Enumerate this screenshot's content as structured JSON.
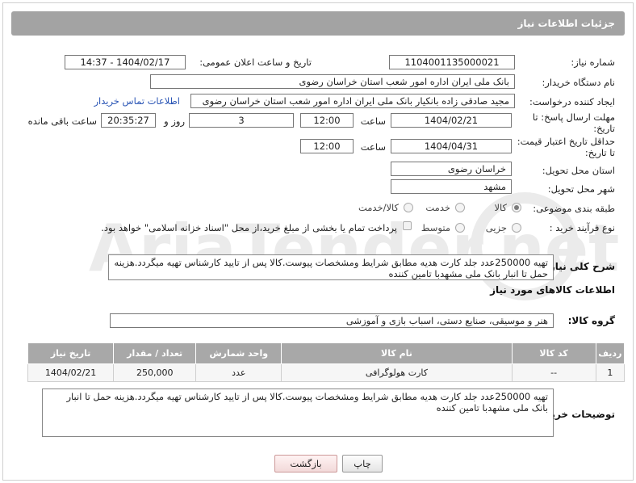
{
  "header": {
    "title": "جزئیات اطلاعات نیاز"
  },
  "form": {
    "need_number_label": "شماره نیاز:",
    "need_number": "1104001135000021",
    "announce_label": "تاریخ و ساعت اعلان عمومی:",
    "announce_value": "1404/02/17 - 14:37",
    "buyer_org_label": "نام دستگاه خریدار:",
    "buyer_org": "بانک ملی ایران اداره امور شعب استان خراسان رضوی",
    "creator_label": "ایجاد کننده درخواست:",
    "creator": "مجید صادقی زاده بانکیار بانک ملی ایران اداره امور شعب استان خراسان رضوی",
    "contact_link": "اطلاعات تماس خریدار",
    "deadline_label_1": "مهلت ارسال پاسخ: تا",
    "deadline_label_2": "تاریخ:",
    "deadline_date": "1404/02/21",
    "time_label": "ساعت",
    "deadline_time": "12:00",
    "days_value": "3",
    "days_label": "روز و",
    "remaining_time": "20:35:27",
    "remaining_label": "ساعت باقی مانده",
    "validity_label_1": "حداقل تاریخ اعتبار قیمت:",
    "validity_label_2": "تا تاریخ:",
    "validity_date": "1404/04/31",
    "validity_time": "12:00",
    "province_label": "استان محل تحویل:",
    "province": "خراسان رضوی",
    "city_label": "شهر محل تحویل:",
    "city": "مشهد",
    "category_label": "طبقه بندی موضوعی:",
    "category_options": [
      "کالا",
      "خدمت",
      "کالا/خدمت"
    ],
    "process_label": "نوع فرآیند خرید :",
    "process_options": [
      "جزیی",
      "متوسط"
    ],
    "payment_note": "پرداخت تمام یا بخشی از مبلغ خرید،از محل \"اسناد خزانه اسلامی\" خواهد بود."
  },
  "summary": {
    "label": "شرح کلی نیاز:",
    "text": "تهیه 250000عدد جلد کارت هدیه مطابق شرایط ومشخصات پیوست.کالا پس از تایید کارشناس تهیه میگردد.هزینه حمل تا انبار بانک ملی مشهدبا تامین کننده"
  },
  "goods": {
    "section_title": "اطلاعات کالاهای مورد نیاز",
    "group_label": "گروه کالا:",
    "group_value": "هنر و موسیقی، صنایع دستی، اسباب بازی و آموزشی",
    "columns": [
      "ردیف",
      "کد کالا",
      "نام کالا",
      "واحد شمارش",
      "تعداد / مقدار",
      "تاریخ نیاز"
    ],
    "rows": [
      {
        "row": "1",
        "code": "--",
        "name": "کارت هولوگرافی",
        "unit": "عدد",
        "qty": "250,000",
        "date": "1404/02/21"
      }
    ]
  },
  "buyer_notes": {
    "label": "توضیحات خریدار:",
    "text": "تهیه 250000عدد جلد کارت هدیه مطابق شرایط ومشخصات پیوست.کالا پس از تایید کارشناس تهیه میگردد.هزینه حمل تا انبار بانک ملی مشهدبا تامین کننده"
  },
  "buttons": {
    "print": "چاپ",
    "back": "بازگشت"
  },
  "watermark": {
    "text": "AriaTender.net"
  }
}
